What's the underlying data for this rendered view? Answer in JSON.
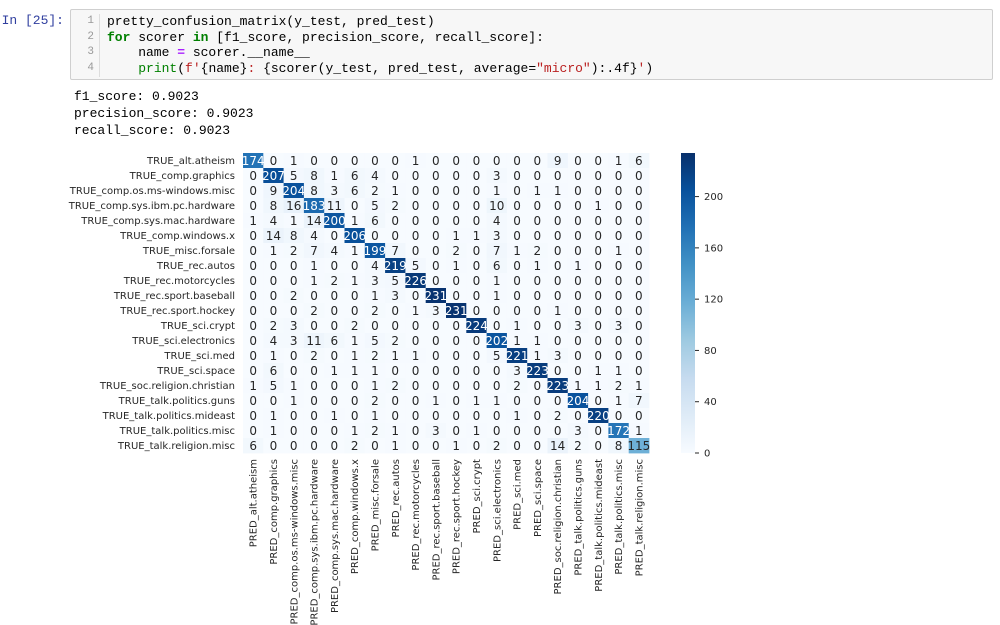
{
  "prompt": "In [25]:",
  "code": {
    "line_numbers": [
      "1",
      "2",
      "3",
      "4"
    ],
    "line1": "pretty_confusion_matrix(y_test, pred_test)",
    "line2": {
      "kw_for": "for",
      "var": " scorer ",
      "kw_in": "in",
      "rest": " [f1_score, precision_score, recall_score]:"
    },
    "line3": {
      "indent": "    name ",
      "op": "=",
      "rest": " scorer.__name__"
    },
    "line4": {
      "indent": "    ",
      "fn": "print",
      "open": "(",
      "str1": "f'",
      "expr1": "{name}",
      "str2": ": ",
      "expr2": "{scorer(y_test, pred_test, average=",
      "str3": "\"micro\"",
      "expr3": "):.4f}",
      "str4": "'",
      "close": ")"
    }
  },
  "output": [
    "f1_score: 0.9023",
    "precision_score: 0.9023",
    "recall_score: 0.9023"
  ],
  "chart_data": {
    "type": "heatmap",
    "rows": [
      "TRUE_alt.atheism",
      "TRUE_comp.graphics",
      "TRUE_comp.os.ms-windows.misc",
      "TRUE_comp.sys.ibm.pc.hardware",
      "TRUE_comp.sys.mac.hardware",
      "TRUE_comp.windows.x",
      "TRUE_misc.forsale",
      "TRUE_rec.autos",
      "TRUE_rec.motorcycles",
      "TRUE_rec.sport.baseball",
      "TRUE_rec.sport.hockey",
      "TRUE_sci.crypt",
      "TRUE_sci.electronics",
      "TRUE_sci.med",
      "TRUE_sci.space",
      "TRUE_soc.religion.christian",
      "TRUE_talk.politics.guns",
      "TRUE_talk.politics.mideast",
      "TRUE_talk.politics.misc",
      "TRUE_talk.religion.misc"
    ],
    "cols": [
      "PRED_alt.atheism",
      "PRED_comp.graphics",
      "PRED_comp.os.ms-windows.misc",
      "PRED_comp.sys.ibm.pc.hardware",
      "PRED_comp.sys.mac.hardware",
      "PRED_comp.windows.x",
      "PRED_misc.forsale",
      "PRED_rec.autos",
      "PRED_rec.motorcycles",
      "PRED_rec.sport.baseball",
      "PRED_rec.sport.hockey",
      "PRED_sci.crypt",
      "PRED_sci.electronics",
      "PRED_sci.med",
      "PRED_sci.space",
      "PRED_soc.religion.christian",
      "PRED_talk.politics.guns",
      "PRED_talk.politics.mideast",
      "PRED_talk.politics.misc",
      "PRED_talk.religion.misc"
    ],
    "values": [
      [
        174,
        0,
        1,
        0,
        0,
        0,
        0,
        0,
        1,
        0,
        0,
        0,
        0,
        0,
        0,
        9,
        0,
        0,
        1,
        6
      ],
      [
        0,
        207,
        5,
        8,
        1,
        6,
        4,
        0,
        0,
        0,
        0,
        0,
        3,
        0,
        0,
        0,
        0,
        0,
        0,
        0
      ],
      [
        0,
        9,
        204,
        8,
        3,
        6,
        2,
        1,
        0,
        0,
        0,
        0,
        1,
        0,
        1,
        1,
        0,
        0,
        0,
        0
      ],
      [
        0,
        8,
        16,
        183,
        11,
        0,
        5,
        2,
        0,
        0,
        0,
        0,
        10,
        0,
        0,
        0,
        0,
        1,
        0,
        0
      ],
      [
        1,
        4,
        1,
        14,
        200,
        1,
        6,
        0,
        0,
        0,
        0,
        0,
        4,
        0,
        0,
        0,
        0,
        0,
        0,
        0
      ],
      [
        0,
        14,
        8,
        4,
        0,
        206,
        0,
        0,
        0,
        0,
        1,
        1,
        3,
        0,
        0,
        0,
        0,
        0,
        0,
        0
      ],
      [
        0,
        1,
        2,
        7,
        4,
        1,
        199,
        7,
        0,
        0,
        2,
        0,
        7,
        1,
        2,
        0,
        0,
        0,
        1,
        0
      ],
      [
        0,
        0,
        0,
        1,
        0,
        0,
        4,
        219,
        5,
        0,
        1,
        0,
        6,
        0,
        1,
        0,
        1,
        0,
        0,
        0
      ],
      [
        0,
        0,
        0,
        1,
        2,
        1,
        3,
        5,
        226,
        0,
        0,
        0,
        1,
        0,
        0,
        0,
        0,
        0,
        0,
        0
      ],
      [
        0,
        0,
        2,
        0,
        0,
        0,
        1,
        3,
        0,
        231,
        0,
        0,
        1,
        0,
        0,
        0,
        0,
        0,
        0,
        0
      ],
      [
        0,
        0,
        0,
        2,
        0,
        0,
        2,
        0,
        1,
        3,
        231,
        0,
        0,
        0,
        0,
        1,
        0,
        0,
        0,
        0
      ],
      [
        0,
        2,
        3,
        0,
        0,
        2,
        0,
        0,
        0,
        0,
        0,
        224,
        0,
        1,
        0,
        0,
        3,
        0,
        3,
        0
      ],
      [
        0,
        4,
        3,
        11,
        6,
        1,
        5,
        2,
        0,
        0,
        0,
        0,
        202,
        1,
        1,
        0,
        0,
        0,
        0,
        0
      ],
      [
        0,
        1,
        0,
        2,
        0,
        1,
        2,
        1,
        1,
        0,
        0,
        0,
        5,
        221,
        1,
        3,
        0,
        0,
        0,
        0
      ],
      [
        0,
        6,
        0,
        0,
        1,
        1,
        1,
        0,
        0,
        0,
        0,
        0,
        0,
        3,
        223,
        0,
        0,
        1,
        1,
        0
      ],
      [
        1,
        5,
        1,
        0,
        0,
        0,
        1,
        2,
        0,
        0,
        0,
        0,
        0,
        2,
        0,
        223,
        1,
        1,
        2,
        1
      ],
      [
        0,
        0,
        1,
        0,
        0,
        0,
        2,
        0,
        0,
        1,
        0,
        1,
        1,
        0,
        0,
        0,
        204,
        0,
        1,
        7
      ],
      [
        0,
        1,
        0,
        0,
        1,
        0,
        1,
        0,
        0,
        0,
        0,
        0,
        0,
        1,
        0,
        2,
        0,
        220,
        0,
        0
      ],
      [
        0,
        1,
        0,
        0,
        0,
        1,
        2,
        1,
        0,
        3,
        0,
        1,
        0,
        0,
        0,
        0,
        3,
        0,
        172,
        1
      ],
      [
        6,
        0,
        0,
        0,
        0,
        2,
        0,
        1,
        0,
        0,
        1,
        0,
        2,
        0,
        0,
        14,
        2,
        0,
        8,
        115
      ]
    ],
    "colorbar": {
      "min": 0,
      "max": 234,
      "ticks": [
        0,
        40,
        80,
        120,
        160,
        200
      ]
    },
    "colors": {
      "low": "#f7fbff",
      "high": "#08306b"
    }
  }
}
